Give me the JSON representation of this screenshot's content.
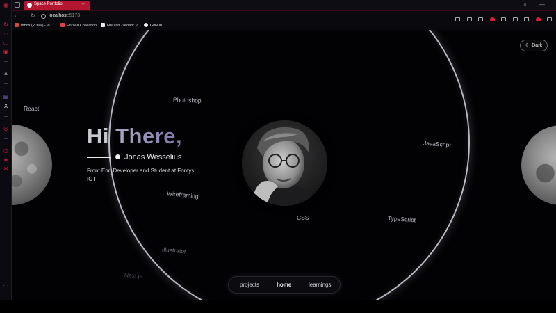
{
  "browser": {
    "tab_title": "Space Portfolio",
    "url_host": "localhost",
    "url_port": ":5173",
    "bookmarks": [
      {
        "label": "Inbox (2.399) - jo...",
        "color": "#d44a3a"
      },
      {
        "label": "Eorzea Collection",
        "color": "#e0404a"
      },
      {
        "label": "Hisuian Zoroark V...",
        "color": "#eaeaea"
      },
      {
        "label": "GitHub",
        "color": "#eaeaea"
      }
    ],
    "accent": "#b41632"
  },
  "page": {
    "theme_toggle": "Dark",
    "hero": {
      "greeting_part1": "Hi",
      "greeting_part2": "There,",
      "name": "Jonas Wesselius",
      "subtitle": "Front End Developer and Student at Fontys ICT"
    },
    "skills": [
      "React",
      "Photoshop",
      "JavaScript",
      "Wireframing",
      "CSS",
      "TypeScript",
      "Illustrator",
      "Next.js"
    ],
    "nav": {
      "items": [
        "projects",
        "home",
        "learnings"
      ],
      "active": "home"
    }
  }
}
